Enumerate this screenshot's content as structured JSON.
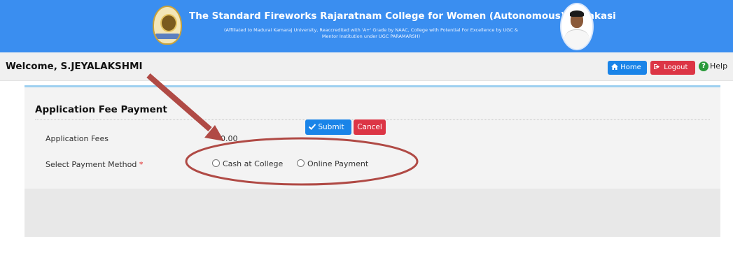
{
  "header": {
    "title": "The Standard Fireworks Rajaratnam College for Women (Autonomous), Sivakasi",
    "subtitle_line1": "(Affiliated to Madurai Kamaraj University, Reaccredited with 'A+' Grade by NAAC, College with Potential For Excellence by UGC &",
    "subtitle_line2": "Mentor Institution under UGC PARAMARSH)",
    "logo_icon": "college-crest-icon",
    "photo_icon": "founder-portrait"
  },
  "topbar": {
    "welcome": "Welcome, S.JEYALAKSHMI",
    "home_label": "Home",
    "logout_label": "Logout",
    "help_label": "Help",
    "home_icon": "home-icon",
    "logout_icon": "logout-icon",
    "help_icon": "question-circle-icon"
  },
  "form": {
    "title": "Application Fee Payment",
    "fees_label": "Application Fees",
    "fees_value": "0.00",
    "method_label": "Select Payment Method",
    "required_mark": "*",
    "options": [
      "Cash at College",
      "Online Payment"
    ],
    "submit_label": "Submit",
    "cancel_label": "Cancel"
  },
  "colors": {
    "header_bg": "#3a8ef0",
    "primary": "#1a84e8",
    "danger": "#dc3545",
    "annotation": "#b04a45"
  }
}
